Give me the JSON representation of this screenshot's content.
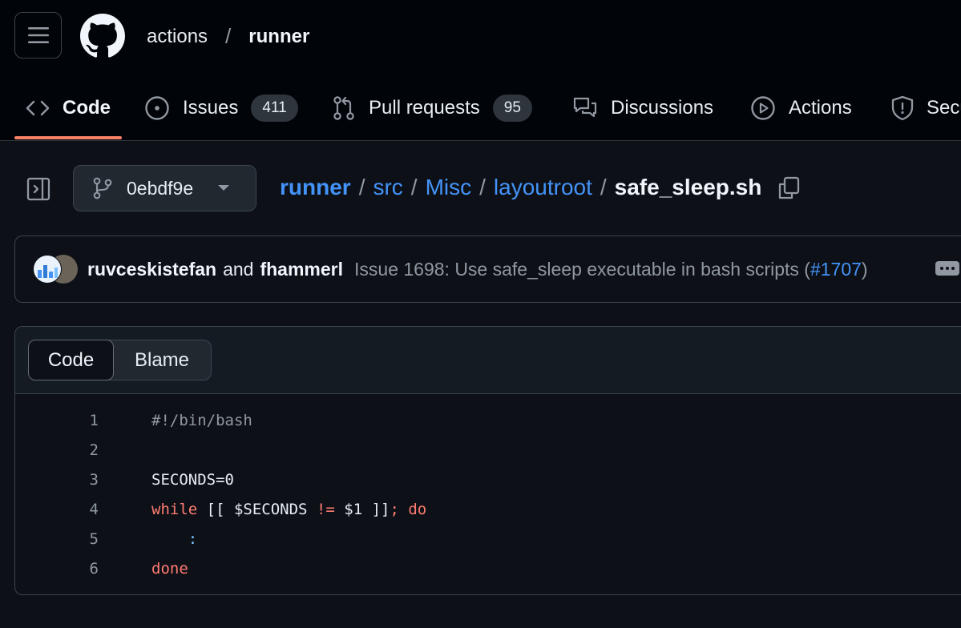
{
  "header": {
    "owner": "actions",
    "separator": "/",
    "repo": "runner"
  },
  "tabs": [
    {
      "label": "Code",
      "icon": "code-icon"
    },
    {
      "label": "Issues",
      "icon": "issue-opened-icon",
      "count": "411"
    },
    {
      "label": "Pull requests",
      "icon": "git-pull-request-icon",
      "count": "95"
    },
    {
      "label": "Discussions",
      "icon": "comment-discussion-icon"
    },
    {
      "label": "Actions",
      "icon": "play-icon"
    },
    {
      "label": "Secu",
      "icon": "shield-icon"
    }
  ],
  "branch": {
    "name": "0ebdf9e"
  },
  "breadcrumb": {
    "root": "runner",
    "parts": [
      "src",
      "Misc",
      "layoutroot"
    ],
    "separator": "/",
    "file": "safe_sleep.sh"
  },
  "commit": {
    "author1": "ruvceskistefan",
    "and": "and",
    "author2": "fhammerl",
    "message": "Issue 1698: Use safe_sleep executable in bash scripts (",
    "link": "#1707",
    "message_end": ")"
  },
  "file_view": {
    "tab_code": "Code",
    "tab_blame": "Blame"
  },
  "code_lines": [
    {
      "n": "1",
      "text": "#!/bin/bash"
    },
    {
      "n": "2",
      "text": ""
    },
    {
      "n": "3",
      "text": "SECONDS=0"
    },
    {
      "n": "4",
      "text": "while [[ $SECONDS != $1 ]]; do"
    },
    {
      "n": "5",
      "text": "    :"
    },
    {
      "n": "6",
      "text": "done"
    }
  ],
  "colors": {
    "accent_link": "#4493f8",
    "active_tab_underline": "#f78166",
    "keyword": "#ff7b72",
    "builtin": "#79c0ff"
  }
}
